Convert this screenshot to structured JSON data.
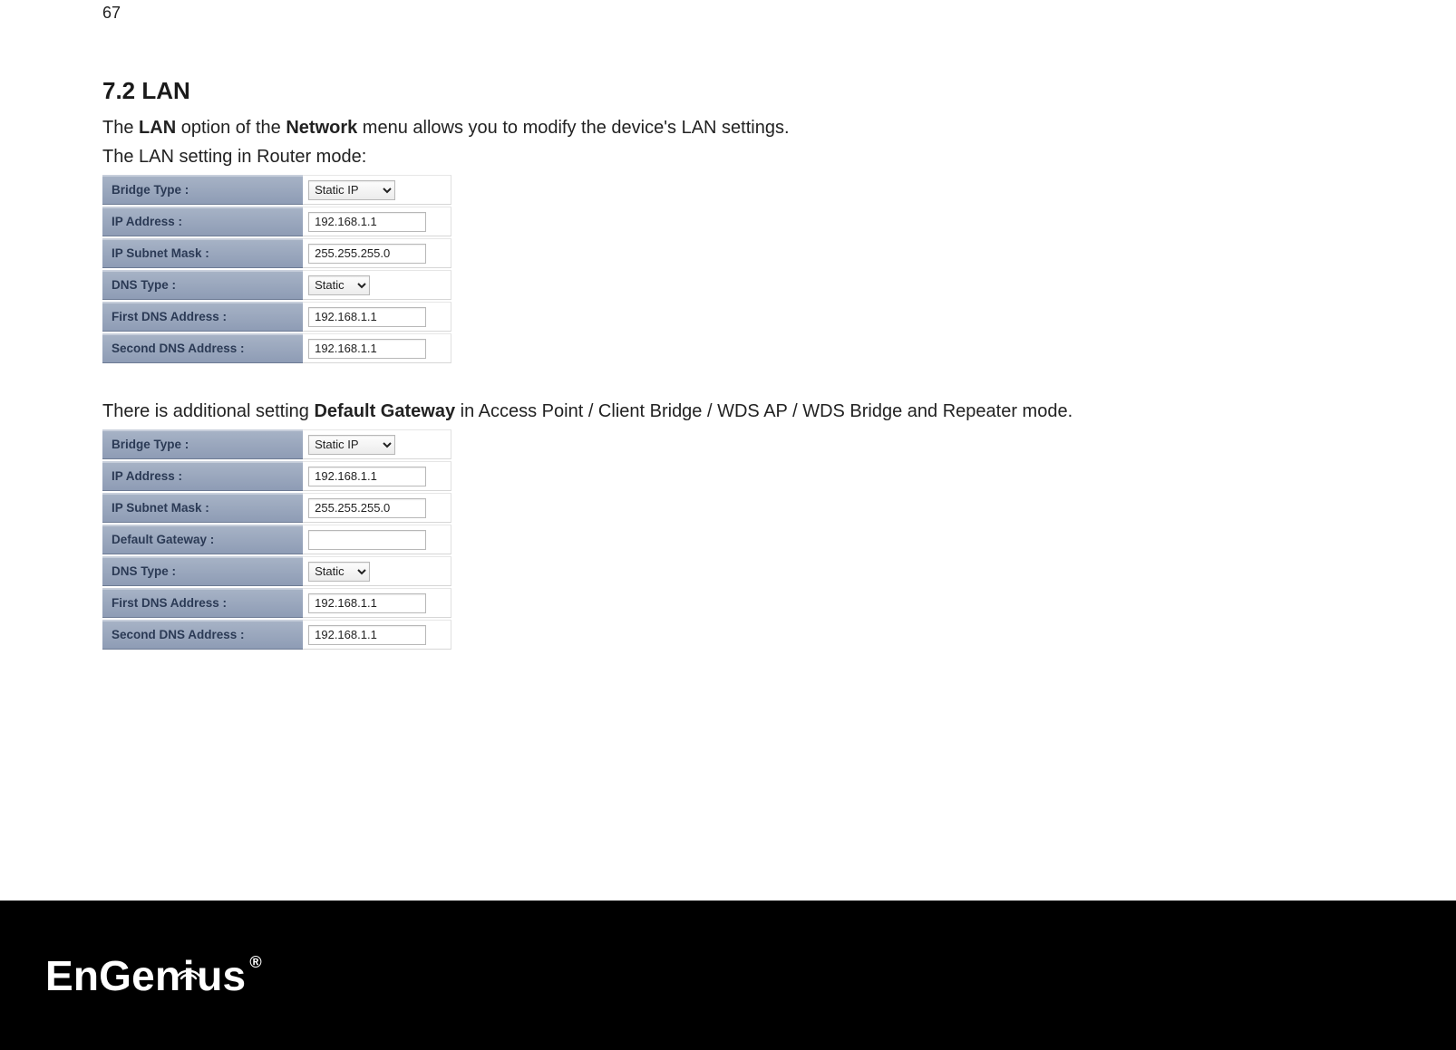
{
  "page_number": "67",
  "heading": "7.2   LAN",
  "intro_pre": "The ",
  "intro_b1": "LAN",
  "intro_mid": " option of the ",
  "intro_b2": "Network",
  "intro_post": " menu allows you to modify the device's LAN settings.",
  "subhead1": "The LAN setting in Router mode:",
  "table1": {
    "rows": [
      {
        "l": "Bridge Type :",
        "type": "select_wide",
        "v": "Static IP"
      },
      {
        "l": "IP Address :",
        "type": "text",
        "v": "192.168.1.1"
      },
      {
        "l": "IP Subnet Mask :",
        "type": "text",
        "v": "255.255.255.0"
      },
      {
        "l": "DNS Type :",
        "type": "select_narrow",
        "v": "Static"
      },
      {
        "l": "First DNS Address :",
        "type": "text",
        "v": "192.168.1.1"
      },
      {
        "l": "Second DNS Address :",
        "type": "text",
        "v": "192.168.1.1"
      }
    ]
  },
  "midtext_pre": "There is additional setting ",
  "midtext_b": "Default Gateway",
  "midtext_post": " in Access Point / Client Bridge / WDS AP / WDS Bridge and Repeater mode.",
  "table2": {
    "rows": [
      {
        "l": "Bridge Type :",
        "type": "select_wide",
        "v": "Static IP"
      },
      {
        "l": "IP Address :",
        "type": "text",
        "v": "192.168.1.1"
      },
      {
        "l": "IP Subnet Mask :",
        "type": "text",
        "v": "255.255.255.0"
      },
      {
        "l": "Default Gateway :",
        "type": "text",
        "v": ""
      },
      {
        "l": "DNS Type :",
        "type": "select_narrow",
        "v": "Static"
      },
      {
        "l": "First DNS Address :",
        "type": "text",
        "v": "192.168.1.1"
      },
      {
        "l": "Second DNS Address :",
        "type": "text",
        "v": "192.168.1.1"
      }
    ]
  },
  "logo": {
    "pre": "EnGen",
    "post": "us",
    "reg": "®"
  }
}
